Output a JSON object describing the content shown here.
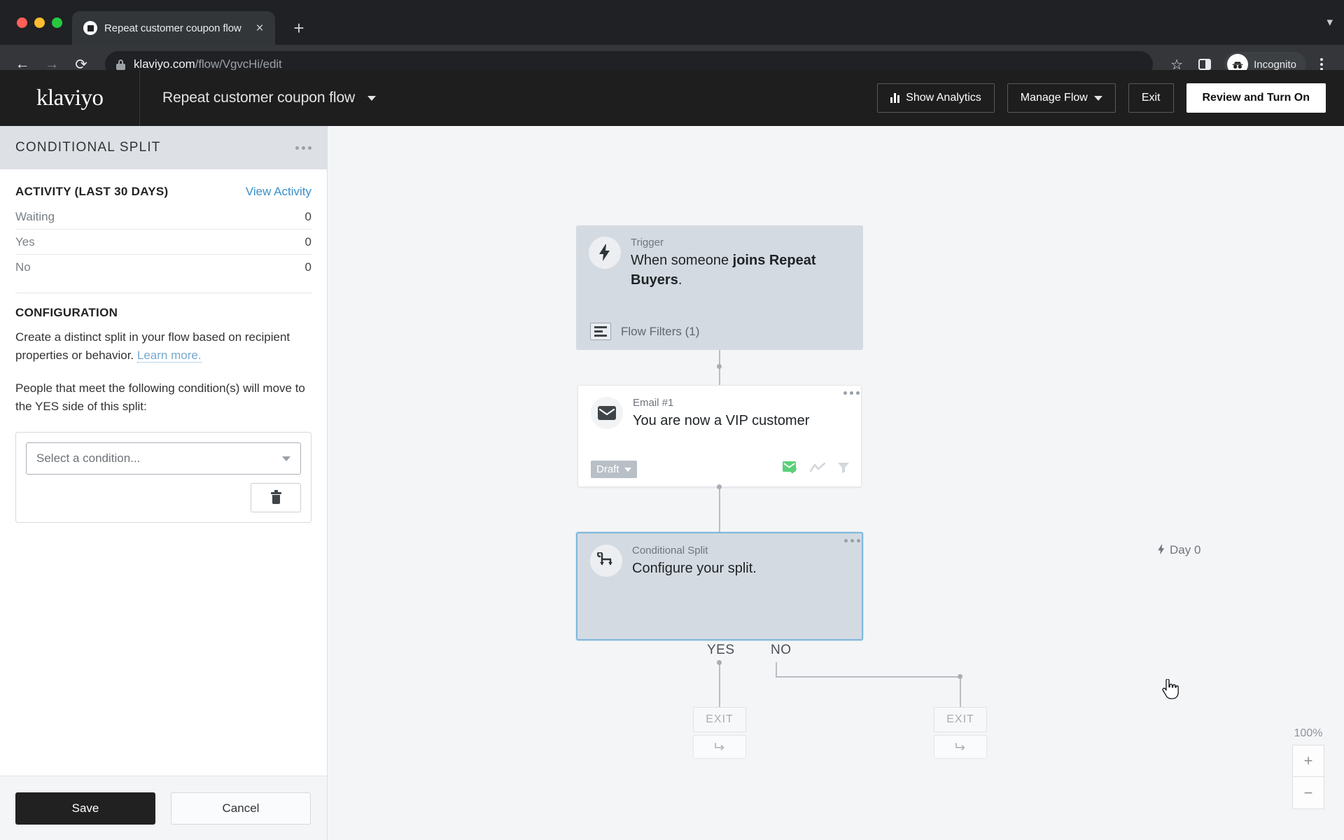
{
  "browser": {
    "tab": {
      "title": "Repeat customer coupon flow",
      "favicon": "klaviyo-favicon",
      "close": "×"
    },
    "new_tab": "+",
    "tab_list_chevron": "▾",
    "nav": {
      "back": "←",
      "forward": "→",
      "reload": "⟳"
    },
    "url": {
      "host": "klaviyo.com",
      "path": "/flow/VgvcHi/edit",
      "lock": "lock-icon"
    },
    "actions": {
      "bookmark": "☆",
      "side_panel": "side-panel-icon",
      "profile": "Incognito",
      "menu": "⋮"
    }
  },
  "app_header": {
    "logo": "klaviyo",
    "flow_name": "Repeat customer coupon flow",
    "buttons": {
      "show_analytics": "Show Analytics",
      "manage_flow": "Manage Flow",
      "exit": "Exit",
      "review_turn_on": "Review and Turn On"
    }
  },
  "panel": {
    "title": "CONDITIONAL SPLIT",
    "activity": {
      "heading": "ACTIVITY (LAST 30 DAYS)",
      "view_link": "View Activity",
      "rows": [
        {
          "label": "Waiting",
          "value": "0"
        },
        {
          "label": "Yes",
          "value": "0"
        },
        {
          "label": "No",
          "value": "0"
        }
      ]
    },
    "configuration": {
      "heading": "CONFIGURATION",
      "description_before": "Create a distinct split in your flow based on recipient properties or behavior. ",
      "learn_more": "Learn more.",
      "instruction": "People that meet the following condition(s) will move to the YES side of this split:",
      "condition_placeholder": "Select a condition...",
      "delete_icon": "trash-icon"
    },
    "footer": {
      "save": "Save",
      "cancel": "Cancel"
    }
  },
  "canvas": {
    "trigger": {
      "label": "Trigger",
      "headline_prefix": "When someone ",
      "headline_bold": "joins Repeat Buyers",
      "headline_suffix": ".",
      "flow_filters": "Flow Filters (1)",
      "icon": "lightning-bolt-icon"
    },
    "email": {
      "label": "Email #1",
      "headline": "You are now a VIP customer",
      "status": "Draft",
      "icon": "envelope-icon",
      "footer_icons": [
        "smart-sending-envelope-icon",
        "skip-icon",
        "filter-funnel-icon"
      ],
      "timing": "Day 0"
    },
    "split": {
      "label": "Conditional Split",
      "headline": "Configure your split.",
      "icon": "branch-split-icon",
      "branch_yes": "YES",
      "branch_no": "NO"
    },
    "exits": [
      {
        "label": "EXIT",
        "add_icon": "add-step-icon"
      },
      {
        "label": "EXIT",
        "add_icon": "add-step-icon"
      }
    ],
    "zoom": {
      "level": "100%",
      "in": "+",
      "out": "−"
    }
  },
  "colors": {
    "accent_blue": "#7fb8dd",
    "link_blue": "#3a8fc7",
    "node_gray": "#d4dae1",
    "canvas_bg": "#f4f5f7",
    "header_dark": "#1e1e1e",
    "green_status": "#5bd07a"
  }
}
